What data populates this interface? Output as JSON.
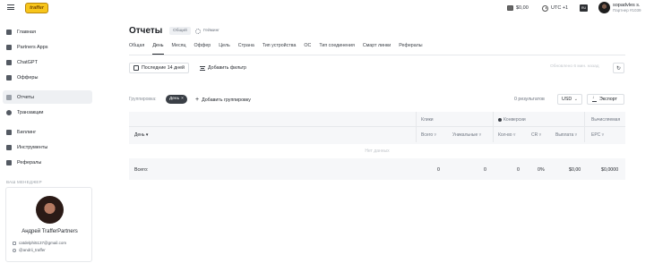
{
  "topbar": {
    "logo_text": "traffer",
    "balance": "$0,00",
    "timezone": "UTC +1",
    "lang": "RU",
    "user_name": "sopadvles s.",
    "user_sub": "Партнер #1039"
  },
  "sidebar": {
    "items": [
      {
        "label": "Главная",
        "icon": "grid-icon"
      },
      {
        "label": "Partners Apps",
        "icon": "apps-icon"
      },
      {
        "label": "ChatGPT",
        "icon": "chatgpt-icon"
      },
      {
        "label": "Офферы",
        "icon": "tag-icon"
      },
      {
        "label": "Отчеты",
        "icon": "chart-icon",
        "active": true
      },
      {
        "label": "Транзакции",
        "icon": "transactions-icon"
      },
      {
        "label": "Биллинг",
        "icon": "billing-icon"
      },
      {
        "label": "Инструменты",
        "icon": "wrench-icon"
      },
      {
        "label": "Рефералы",
        "icon": "referrals-icon"
      }
    ],
    "manager_label": "ВАШ МЕНЕДЖЕР",
    "manager": {
      "name": "Андрей TrafferPartners",
      "email": "catdelphi5137@gmail.com",
      "telegram": "@andrii_traffer"
    }
  },
  "main": {
    "title": "Отчеты",
    "pill": "Общий",
    "gaming_tab": "Гейминг",
    "tabs": [
      "Общая",
      "День",
      "Месяц",
      "Оффер",
      "Цель",
      "Страна",
      "Тип устройства",
      "ОС",
      "Тип соединения",
      "Смарт линки",
      "Рефералы"
    ],
    "active_tab": "День",
    "date_range": "Последние 14 дней",
    "add_filter": "Добавить фильтр",
    "updated": "Обновлено 6 мин. назад",
    "grouping_label": "Группировка:",
    "grouping_chip": "День",
    "grouping_chip_close": "×",
    "add_grouping": "Добавить группировку",
    "results": "0  результатов",
    "currency": "USD",
    "export": "Экспорт"
  },
  "table": {
    "group_clicks": "Клики",
    "group_conversions": "Конверсии",
    "group_calculated": "Вычисляемая",
    "col_day": "День ▾",
    "col_total": "Всего ▿",
    "col_unique": "Уникальные ▿",
    "col_count": "Кол-во ▿",
    "col_cr": "CR ▿",
    "col_payout": "Выплата ▿",
    "col_epc": "EPC ▿",
    "empty": "Нет данных",
    "totals": {
      "label": "Всего:",
      "total": "0",
      "unique": "0",
      "count": "0",
      "cr": "0%",
      "payout": "$0,00",
      "epc": "$0,0000"
    }
  }
}
